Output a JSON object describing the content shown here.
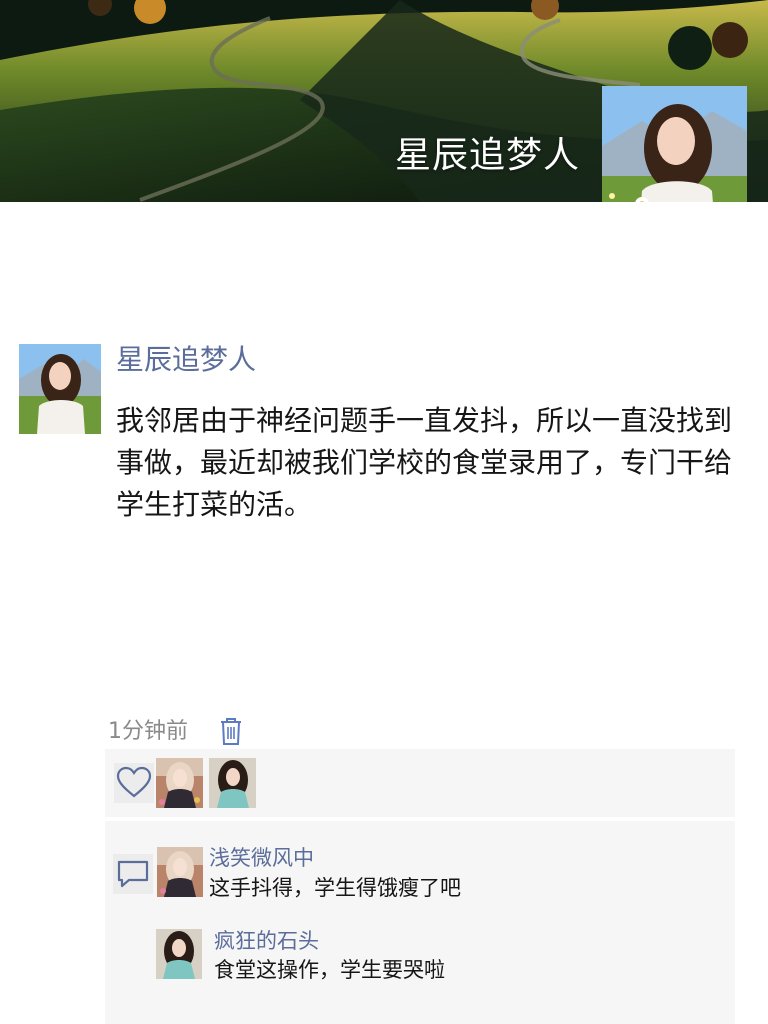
{
  "cover": {
    "name": "星辰追梦人",
    "avatar_icon": "profile-photo-woman-in-flower-field"
  },
  "post": {
    "author": "星辰追梦人",
    "text": "我邻居由于神经问题手一直发抖，所以一直没找到事做，最近却被我们学校的食堂录用了，专门干给学生打菜的活。",
    "time": "1分钟前",
    "delete_icon": "trash-icon"
  },
  "likes": {
    "icon": "heart-icon",
    "avatars": [
      "liker-avatar-1",
      "liker-avatar-2"
    ]
  },
  "comments": {
    "icon": "comment-bubble-icon",
    "items": [
      {
        "author": "浅笑微风中",
        "text": "这手抖得，学生得饿瘦了吧"
      },
      {
        "author": "疯狂的石头",
        "text": "食堂这操作，学生要哭啦"
      }
    ]
  },
  "colors": {
    "link_blue": "#5b6d9a",
    "panel_bg": "#f6f6f6",
    "time_gray": "#8a8a8a"
  }
}
